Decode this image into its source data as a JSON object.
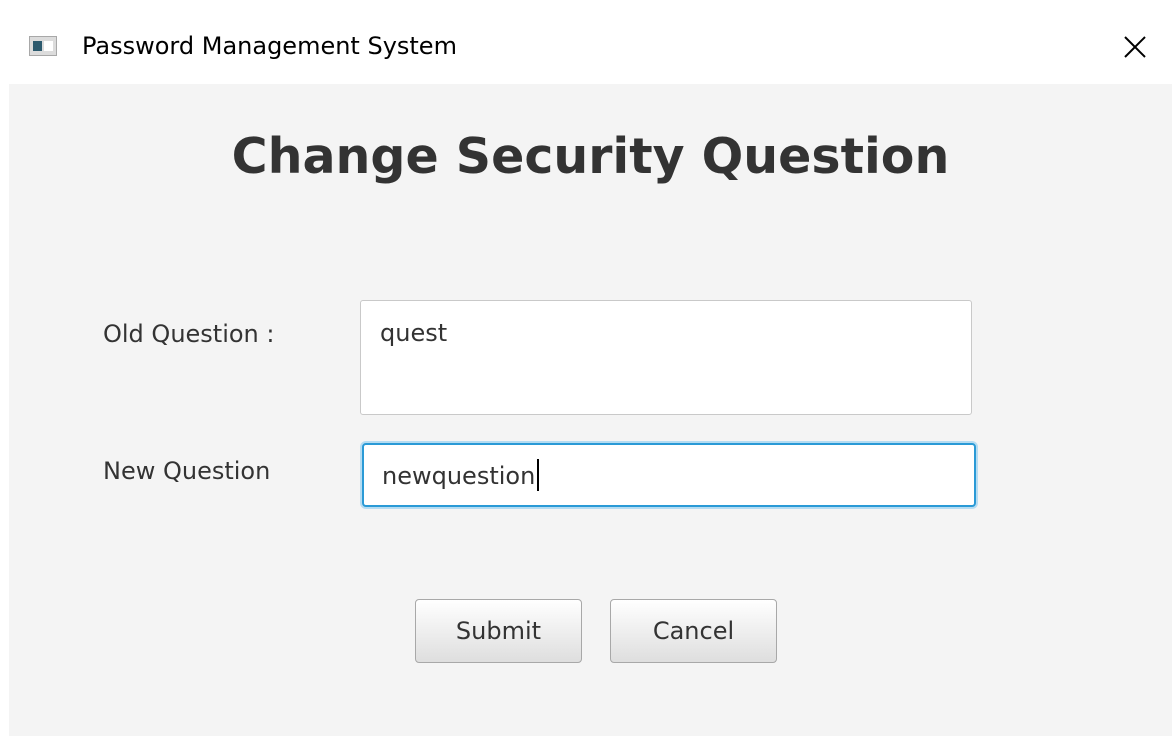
{
  "window": {
    "title": "Password Management System",
    "app_icon": "window-icon",
    "close_icon": "close-icon"
  },
  "form": {
    "heading": "Change Security Question",
    "old_question_label": "Old Question :",
    "old_question_value": "quest",
    "new_question_label": "New Question",
    "new_question_value": "newquestion"
  },
  "buttons": {
    "submit_label": "Submit",
    "cancel_label": "Cancel"
  },
  "colors": {
    "focus_border": "#2a9ad6",
    "background": "#f4f4f4"
  }
}
